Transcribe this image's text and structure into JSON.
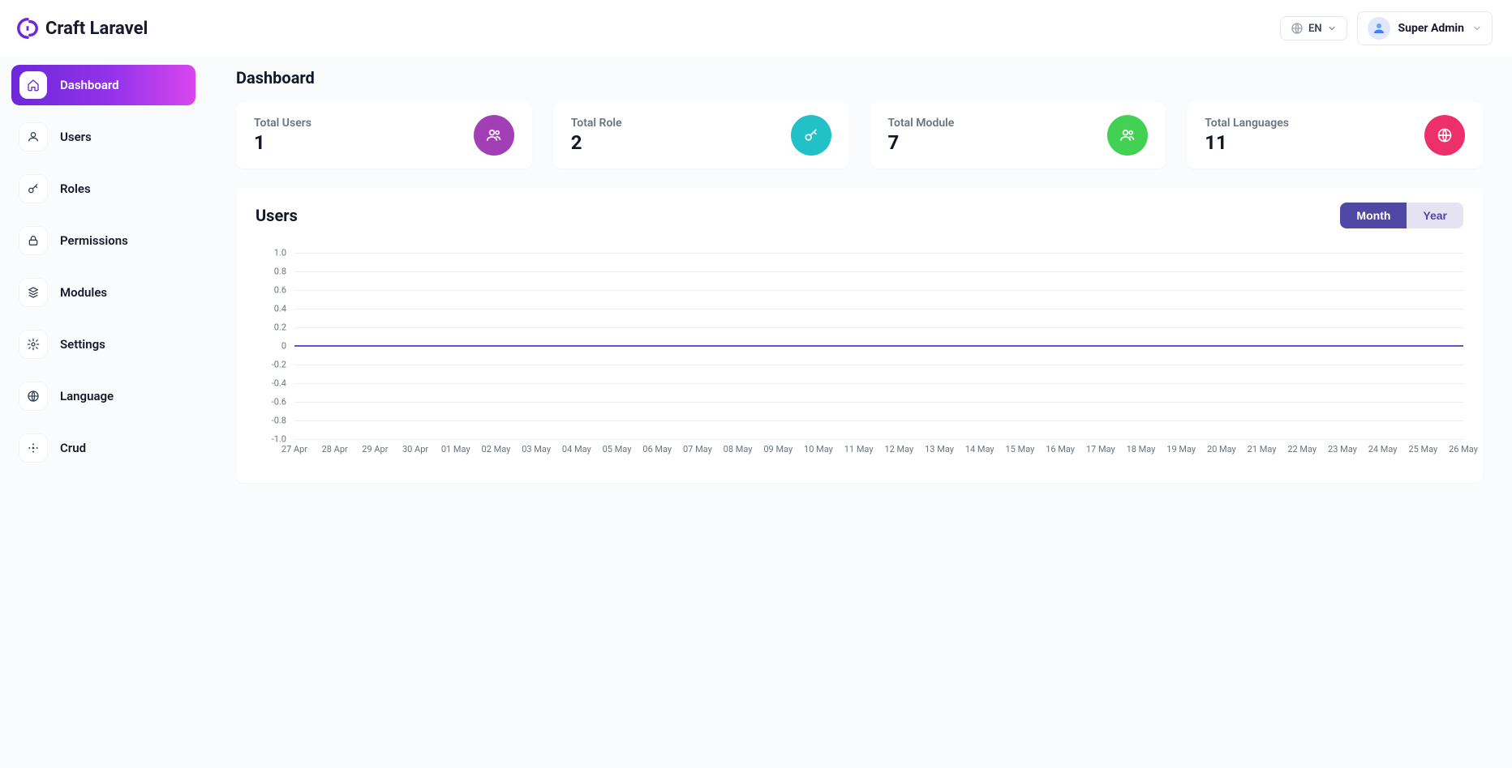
{
  "brand": {
    "name": "Craft Laravel"
  },
  "header": {
    "lang": {
      "code": "EN"
    },
    "user_name": "Super Admin"
  },
  "sidebar": {
    "items": [
      {
        "key": "dashboard",
        "label": "Dashboard",
        "icon": "home",
        "active": true
      },
      {
        "key": "users",
        "label": "Users",
        "icon": "user",
        "active": false
      },
      {
        "key": "roles",
        "label": "Roles",
        "icon": "key",
        "active": false
      },
      {
        "key": "permissions",
        "label": "Permissions",
        "icon": "lock",
        "active": false
      },
      {
        "key": "modules",
        "label": "Modules",
        "icon": "stack",
        "active": false
      },
      {
        "key": "settings",
        "label": "Settings",
        "icon": "gear",
        "active": false
      },
      {
        "key": "language",
        "label": "Language",
        "icon": "globe",
        "active": false
      },
      {
        "key": "crud",
        "label": "Crud",
        "icon": "crud",
        "active": false
      }
    ]
  },
  "page": {
    "title": "Dashboard"
  },
  "stats": [
    {
      "label": "Total Users",
      "value": "1",
      "icon": "users",
      "color": "purple"
    },
    {
      "label": "Total Role",
      "value": "2",
      "icon": "key",
      "color": "teal"
    },
    {
      "label": "Total Module",
      "value": "7",
      "icon": "users",
      "color": "green"
    },
    {
      "label": "Total Languages",
      "value": "11",
      "icon": "globe",
      "color": "pink"
    }
  ],
  "panel": {
    "title": "Users",
    "segments": {
      "month": "Month",
      "year": "Year",
      "active": "month"
    }
  },
  "chart_data": {
    "type": "line",
    "title": "Users",
    "xlabel": "",
    "ylabel": "",
    "ylim": [
      -1.0,
      1.0
    ],
    "y_ticks": [
      1.0,
      0.8,
      0.6,
      0.4,
      0.2,
      0,
      -0.2,
      -0.4,
      -0.6,
      -0.8,
      -1.0
    ],
    "categories": [
      "27 Apr",
      "28 Apr",
      "29 Apr",
      "30 Apr",
      "01 May",
      "02 May",
      "03 May",
      "04 May",
      "05 May",
      "06 May",
      "07 May",
      "08 May",
      "09 May",
      "10 May",
      "11 May",
      "12 May",
      "13 May",
      "14 May",
      "15 May",
      "16 May",
      "17 May",
      "18 May",
      "19 May",
      "20 May",
      "21 May",
      "22 May",
      "23 May",
      "24 May",
      "25 May",
      "26 May"
    ],
    "series": [
      {
        "name": "Users",
        "values": [
          0,
          0,
          0,
          0,
          0,
          0,
          0,
          0,
          0,
          0,
          0,
          0,
          0,
          0,
          0,
          0,
          0,
          0,
          0,
          0,
          0,
          0,
          0,
          0,
          0,
          0,
          0,
          0,
          0,
          0
        ]
      }
    ]
  }
}
